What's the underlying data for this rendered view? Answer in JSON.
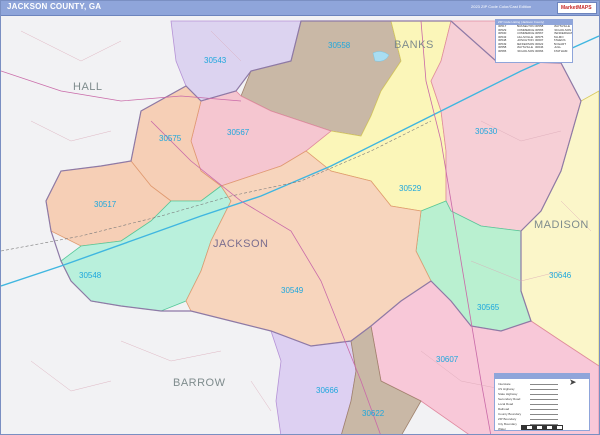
{
  "title": "JACKSON COUNTY, GA",
  "subtitle": "2023 ZIP Code Color/Cast Edition",
  "logo_text": "MarketMAPS",
  "counties": {
    "main": "JACKSON",
    "hall": "HALL",
    "banks": "BANKS",
    "madison": "MADISON",
    "barrow": "BARROW"
  },
  "zip_labels": {
    "z30558": "30558",
    "z30543": "30543",
    "z30567": "30567",
    "z30575": "30575",
    "z30530": "30530",
    "z30529": "30529",
    "z30517": "30517",
    "z30548": "30548",
    "z30549": "30549",
    "z30646": "30646",
    "z30565": "30565",
    "z30607": "30607",
    "z30666": "30666",
    "z30622": "30622"
  },
  "zip_table": {
    "header": "ZIP Code Listing (Jackson County)",
    "rows": [
      [
        "30517",
        "BRASELTON",
        "30558",
        "MAYSVILLE"
      ],
      [
        "30529",
        "COMMERCE",
        "30565",
        "NICHOLSON"
      ],
      [
        "30530",
        "COMMERCE",
        "30567",
        "PENDERGRASS"
      ],
      [
        "30543",
        "GILLSVILLE",
        "30575",
        "TALMO"
      ],
      [
        "30548",
        "HOSCHTON",
        "30607",
        "ATHENS"
      ],
      [
        "30549",
        "JEFFERSON",
        "30622",
        "BOGART"
      ],
      [
        "30558",
        "MAYSVILLE",
        "30646",
        "HULL"
      ],
      [
        "30565",
        "NICHOLSON",
        "30666",
        "STATHAM"
      ]
    ]
  },
  "legend": {
    "items": [
      "Interstate",
      "US Highway",
      "State Highway",
      "Secondary Road",
      "Local Road",
      "Railroad",
      "County Boundary",
      "ZIP Boundary",
      "City Boundary",
      "Water"
    ]
  },
  "colors": {
    "title_bar": "#8fa5da",
    "zip_label": "#1ea7dd",
    "z30558": "#c9b8a6",
    "z30543": "#dcd3f0",
    "z30567": "#f5c6d0",
    "z30575": "#f6cfb6",
    "z30530": "#f6cfd6",
    "z30529": "#fbf6b9",
    "z30517": "#f6cfb6",
    "z30548": "#b9f0dc",
    "z30549": "#f7d5bd",
    "z30646": "#fbf6c9",
    "z30565": "#b9f0d0",
    "z30607": "#f8c8d8",
    "z30666": "#ddd0f2",
    "z30622": "#c9b8a6"
  }
}
